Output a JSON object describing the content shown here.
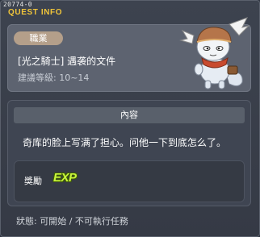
{
  "window": {
    "quest_id": "20774-0",
    "title": "QUEST INFO"
  },
  "info": {
    "job_badge": "職業",
    "quest_title": "[光之騎士] 遇袭的文件",
    "level_req": "建議等級: 10~14"
  },
  "content": {
    "header": "內容",
    "text": "奇库的脸上写满了担心。问他一下到底怎么了。"
  },
  "reward": {
    "label": "獎勵",
    "exp_icon_text": "EXP"
  },
  "status": {
    "text": "狀態:  可開始 / 不可執行任務"
  },
  "colors": {
    "title_accent": "#f0c53a",
    "exp_green": "#c8f53b",
    "badge": "#b49f8a"
  }
}
